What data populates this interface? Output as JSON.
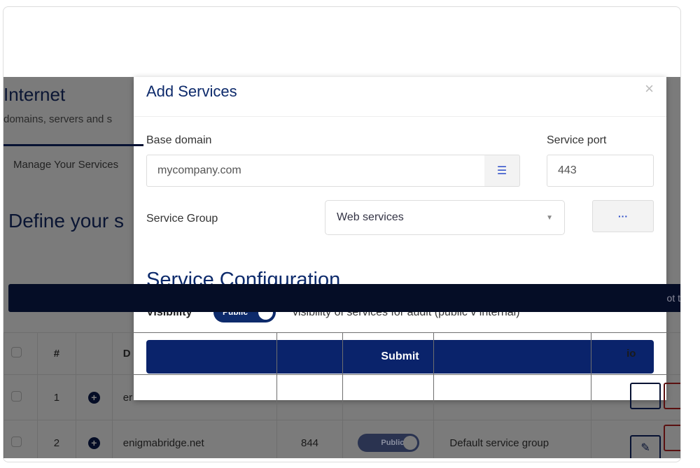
{
  "background": {
    "page_title": "Internet",
    "page_subtitle": "domains, servers and s",
    "tab": "Manage Your Services",
    "section_title": "Define your s",
    "bar_text": "ot t",
    "table": {
      "headers": {
        "num": "#",
        "domain": "D",
        "actions": "io"
      },
      "rows": [
        {
          "num": "1",
          "domain": "er",
          "port": "",
          "visibility": "",
          "group": ""
        },
        {
          "num": "2",
          "domain": "enigmabridge.net",
          "port": "844",
          "visibility": "Public",
          "group": "Default service group"
        }
      ]
    }
  },
  "modal": {
    "title": "Add Services",
    "close": "×",
    "base_domain_label": "Base domain",
    "base_domain_value": "mycompany.com",
    "list_icon": "list-icon",
    "service_port_label": "Service port",
    "service_port_value": "443",
    "service_group_label": "Service Group",
    "service_group_value": "Web services",
    "more_button": "···",
    "config_title": "Service Configuration",
    "visibility_label": "Visibility",
    "visibility_toggle": "Public",
    "visibility_on": true,
    "visibility_desc": "visibility of services for audit (public v internal)",
    "submit": "Submit"
  },
  "colors": {
    "primary": "#0a236b",
    "title": "#0d2a6b",
    "danger": "#a01818"
  }
}
